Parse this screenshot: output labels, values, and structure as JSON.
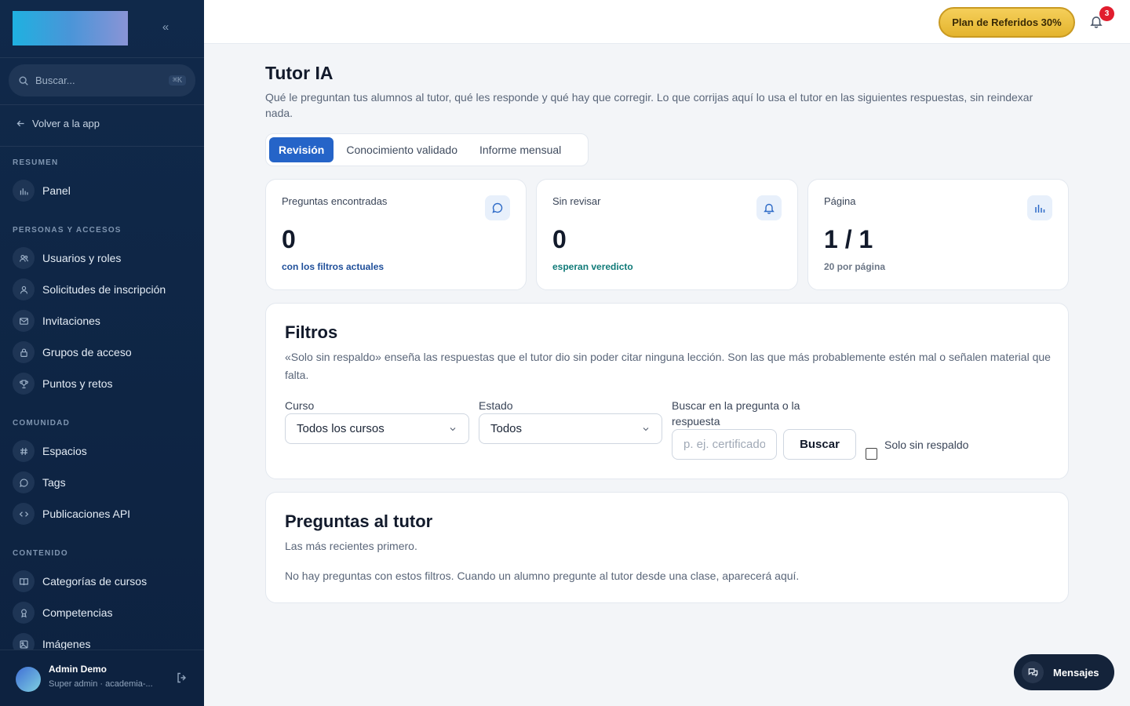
{
  "sidebar": {
    "search_placeholder": "Buscar...",
    "search_shortcut": "⌘K",
    "back_label": "Volver a la app",
    "sections": [
      {
        "label": "RESUMEN",
        "items": [
          {
            "label": "Panel",
            "icon": "bar-chart-icon"
          }
        ]
      },
      {
        "label": "PERSONAS Y ACCESOS",
        "items": [
          {
            "label": "Usuarios y roles",
            "icon": "users-icon"
          },
          {
            "label": "Solicitudes de inscripción",
            "icon": "user-icon"
          },
          {
            "label": "Invitaciones",
            "icon": "mail-icon"
          },
          {
            "label": "Grupos de acceso",
            "icon": "lock-icon"
          },
          {
            "label": "Puntos y retos",
            "icon": "trophy-icon"
          }
        ]
      },
      {
        "label": "COMUNIDAD",
        "items": [
          {
            "label": "Espacios",
            "icon": "hash-icon"
          },
          {
            "label": "Tags",
            "icon": "chat-bubble-icon"
          },
          {
            "label": "Publicaciones API",
            "icon": "code-icon"
          }
        ]
      },
      {
        "label": "CONTENIDO",
        "items": [
          {
            "label": "Categorías de cursos",
            "icon": "book-icon"
          },
          {
            "label": "Competencias",
            "icon": "award-icon"
          },
          {
            "label": "Imágenes",
            "icon": "image-icon"
          }
        ]
      }
    ],
    "user": {
      "name": "Admin Demo",
      "role": "Super admin · academia-..."
    }
  },
  "topbar": {
    "referral_label": "Plan de Referidos 30%",
    "notifications_count": "3"
  },
  "page": {
    "title": "Tutor IA",
    "subtitle": "Qué le preguntan tus alumnos al tutor, qué les responde y qué hay que corregir. Lo que corrijas aquí lo usa el tutor en las siguientes respuestas, sin reindexar nada.",
    "tabs": [
      "Revisión",
      "Conocimiento validado",
      "Informe mensual"
    ],
    "active_tab": 0
  },
  "stats": [
    {
      "label": "Preguntas encontradas",
      "value": "0",
      "note": "con los filtros actuales",
      "note_color": "#1f4f9a",
      "icon": "chat-bubble-icon"
    },
    {
      "label": "Sin revisar",
      "value": "0",
      "note": "esperan veredicto",
      "note_color": "#0f7a78",
      "icon": "bell-icon"
    },
    {
      "label": "Página",
      "value": "1 / 1",
      "note": "20 por página",
      "note_color": "#6b7686",
      "icon": "bar-chart-icon"
    }
  ],
  "filters": {
    "title": "Filtros",
    "description": "«Solo sin respaldo» enseña las respuestas que el tutor dio sin poder citar ninguna lección. Son las que más probablemente estén mal o señalen material que falta.",
    "course_label": "Curso",
    "course_value": "Todos los cursos",
    "status_label": "Estado",
    "status_value": "Todos",
    "search_label": "Buscar en la pregunta o la respuesta",
    "search_placeholder": "p. ej. certificado",
    "search_button": "Buscar",
    "unbacked_label": "Solo sin respaldo"
  },
  "questions": {
    "title": "Preguntas al tutor",
    "subtitle": "Las más recientes primero.",
    "empty": "No hay preguntas con estos filtros. Cuando un alumno pregunte al tutor desde una clase, aparecerá aquí."
  },
  "messages_button": "Mensajes"
}
